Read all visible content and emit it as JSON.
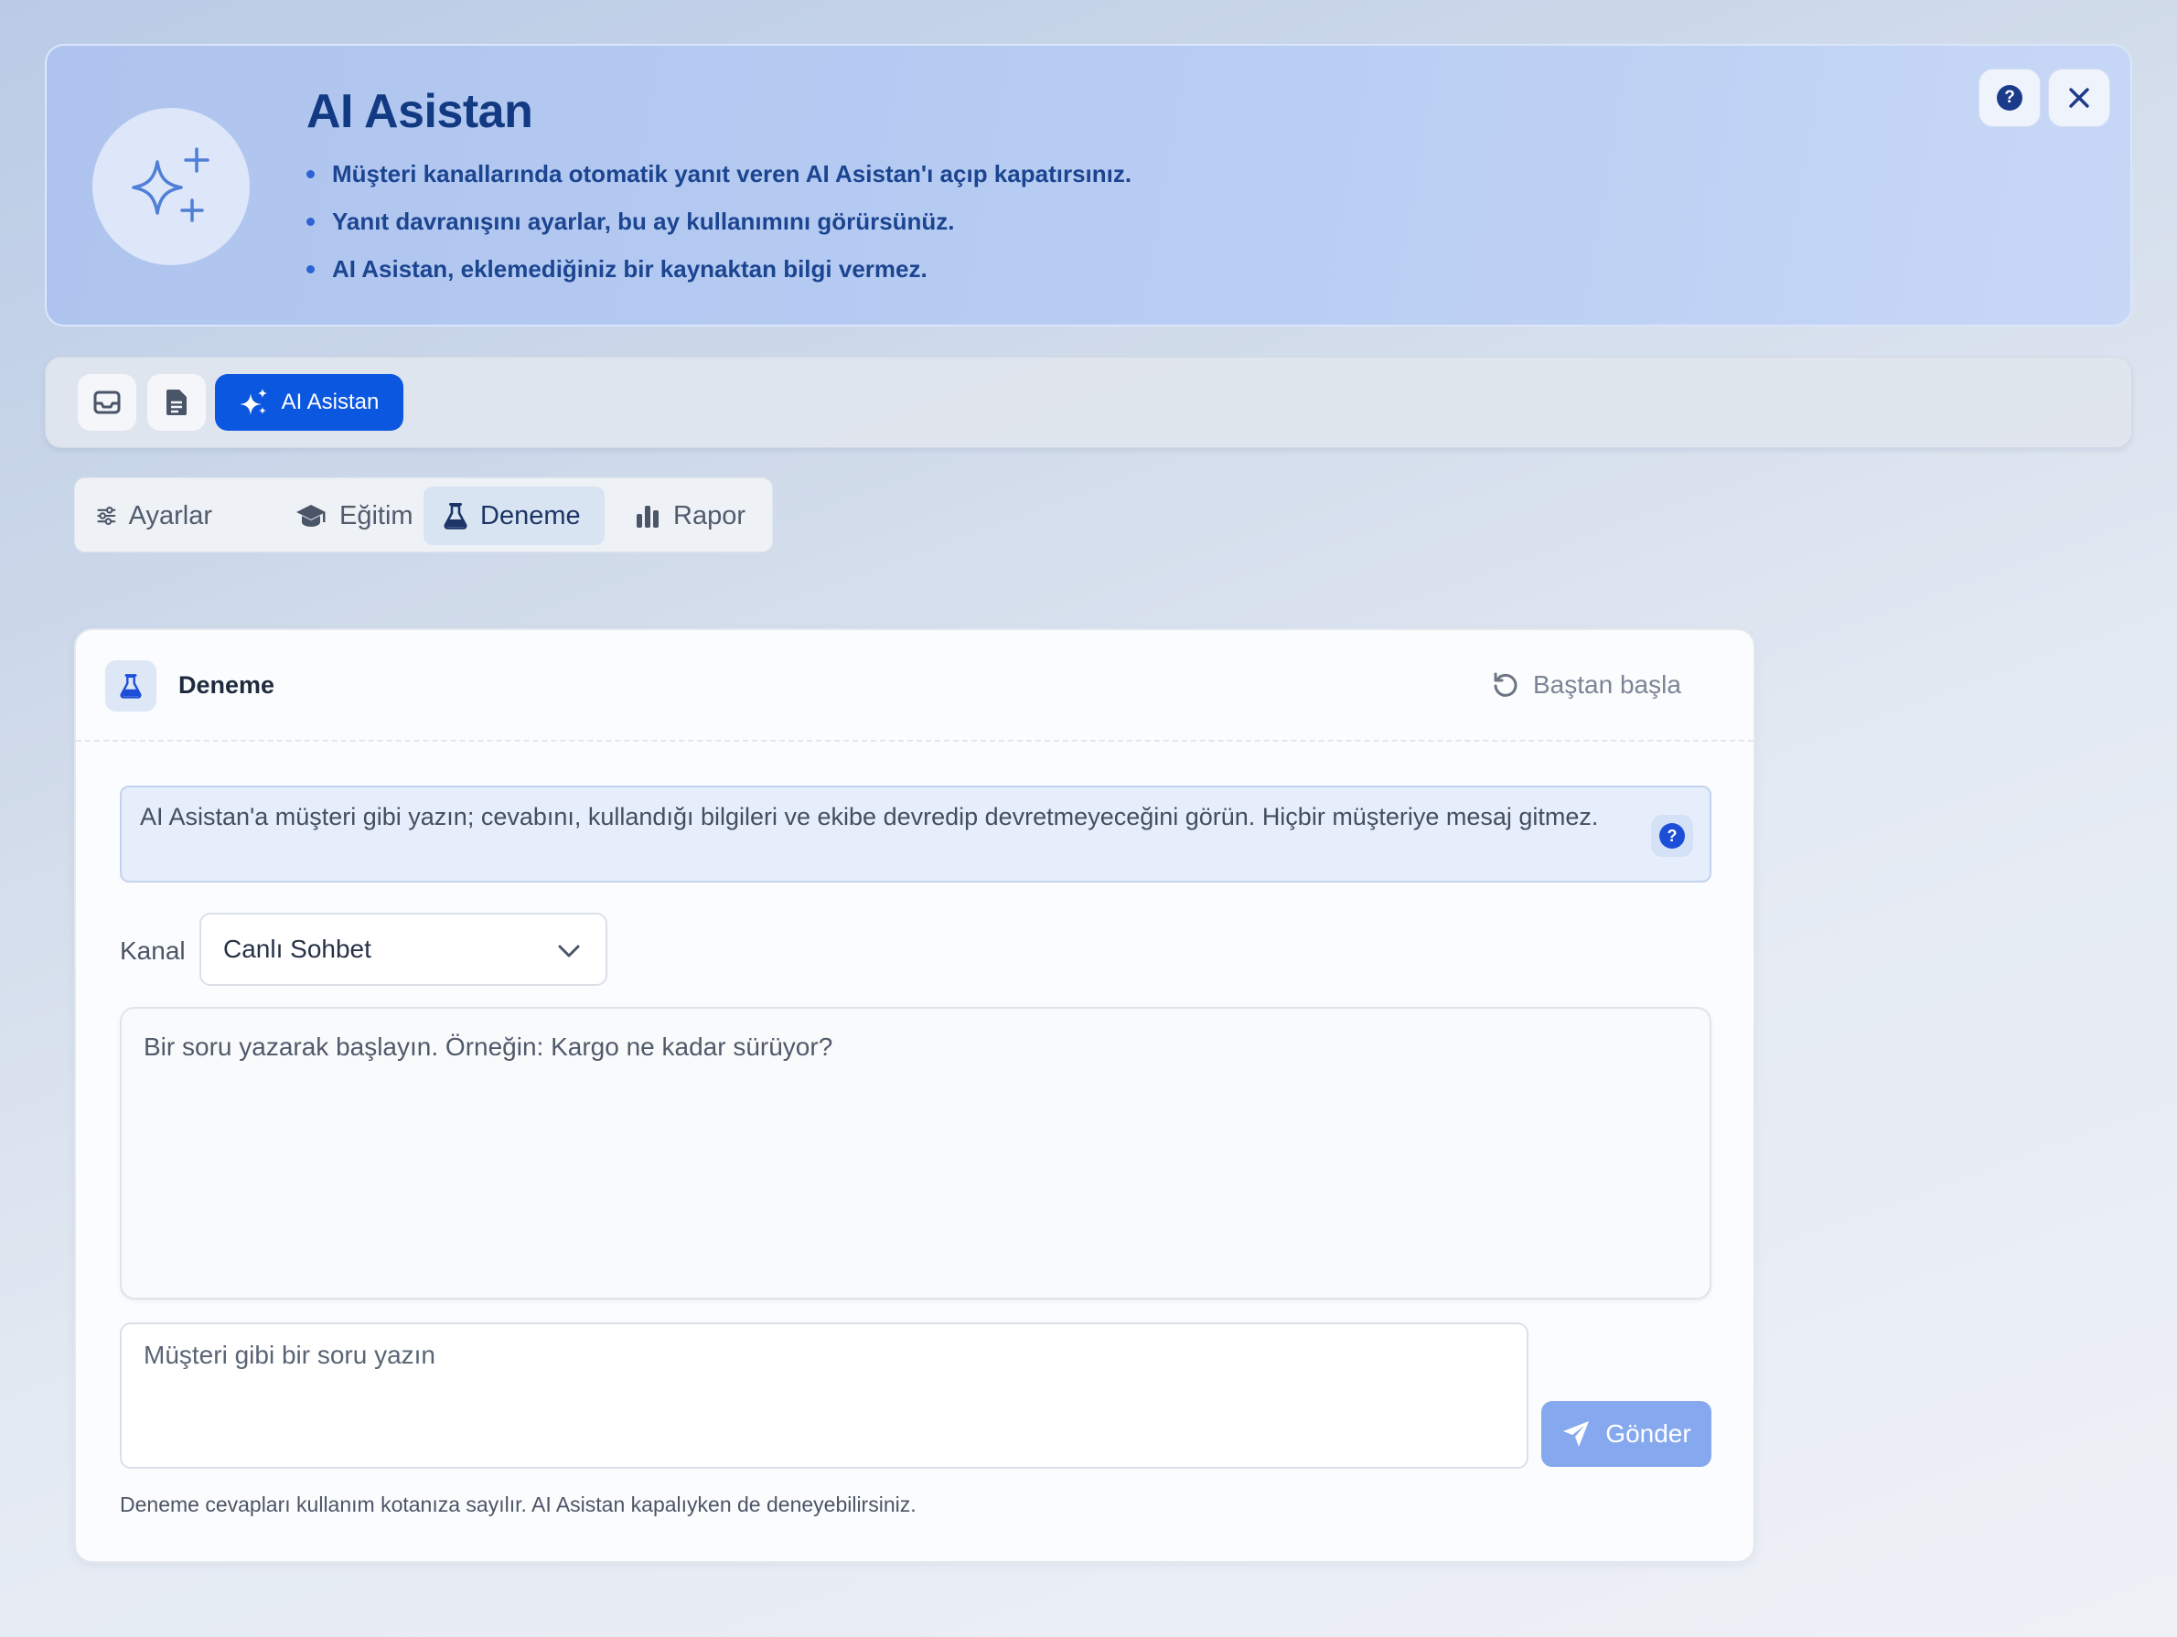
{
  "banner": {
    "title": "AI Asistan",
    "bullets": [
      "Müşteri kanallarında otomatik yanıt veren AI Asistan'ı açıp kapatırsınız.",
      "Yanıt davranışını ayarlar, bu ay kullanımını görürsünüz.",
      "AI Asistan, eklemediğiniz bir kaynaktan bilgi vermez."
    ],
    "help_icon": "question-circle-icon",
    "close_icon": "close-icon",
    "logo_icon": "sparkles-icon"
  },
  "navbar": {
    "items": [
      {
        "icon": "inbox-icon"
      },
      {
        "icon": "document-icon"
      },
      {
        "icon": "sparkles-icon",
        "label": "AI Asistan",
        "active": true
      }
    ],
    "accent": "#0c57e0"
  },
  "tabs": [
    {
      "label": "Ayarlar",
      "icon": "sliders-icon"
    },
    {
      "label": "Eğitim",
      "icon": "graduation-cap-icon"
    },
    {
      "label": "Deneme",
      "icon": "flask-icon",
      "active": true
    },
    {
      "label": "Rapor",
      "icon": "bar-chart-icon"
    }
  ],
  "card": {
    "title": "Deneme",
    "restart_label": "Baştan başla",
    "info": "AI Asistan'a müşteri gibi yazın; cevabını, kullandığı bilgileri ve ekibe devredip devretmeyeceğini görün. Hiçbir müşteriye mesaj gitmez.",
    "kanal_label": "Kanal",
    "kanal_value": "Canlı Sohbet",
    "chat_empty": "Bir soru yazarak başlayın. Örneğin: Kargo ne kadar sürüyor?",
    "input_placeholder": "Müşteri gibi bir soru yazın",
    "send_label": "Gönder",
    "footnote": "Deneme cevapları kullanım kotanıza sayılır. AI Asistan kapalıyken de deneyebilirsiniz."
  }
}
